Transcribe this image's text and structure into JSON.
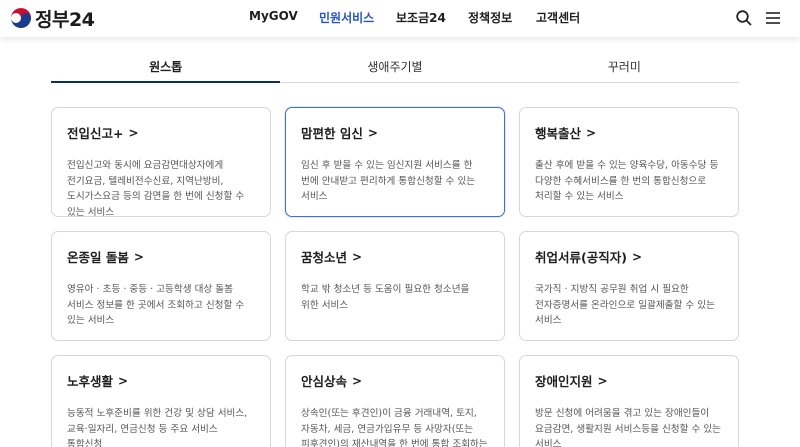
{
  "header": {
    "logo_text": "정부24",
    "nav": [
      {
        "label": "MyGOV",
        "active": false
      },
      {
        "label": "민원서비스",
        "active": true
      },
      {
        "label": "보조금24",
        "active": false
      },
      {
        "label": "정책정보",
        "active": false
      },
      {
        "label": "고객센터",
        "active": false
      }
    ],
    "icons": [
      "search-icon",
      "menu-icon"
    ]
  },
  "tabs": [
    {
      "label": "원스톱",
      "active": true
    },
    {
      "label": "생애주기별",
      "active": false
    },
    {
      "label": "꾸러미",
      "active": false
    }
  ],
  "cards": [
    {
      "title": "전입신고+",
      "desc": "전입신고와 동시에 요금감면대상자에게 전기요금, 텔레비전수신료, 지역난방비, 도시가스요금 등의 감면을 한 번에 신청할 수 있는 서비스",
      "highlight": false
    },
    {
      "title": "맘편한 임신",
      "desc": "임신 후 받을 수 있는 임신지원 서비스를 한 번에 안내받고 편리하게 통합신청할 수 있는 서비스",
      "highlight": true
    },
    {
      "title": "행복출산",
      "desc": "출산 후에 받을 수 있는 양육수당, 아동수당 등 다양한 수혜서비스를 한 번의 통합신청으로 처리할 수 있는 서비스",
      "highlight": false
    },
    {
      "title": "온종일 돌봄",
      "desc": "영유아 · 초등 · 중등 · 고등학생 대상 돌봄 서비스 정보를 한 곳에서 조회하고 신청할 수 있는 서비스",
      "highlight": false
    },
    {
      "title": "꿈청소년",
      "desc": "학교 밖 청소년 등 도움이 필요한 청소년을 위한 서비스",
      "highlight": false
    },
    {
      "title": "취업서류(공직자)",
      "desc": "국가직 · 지방직 공무원 취업 시 필요한 전자증명서를 온라인으로 일괄제출할 수 있는 서비스",
      "highlight": false
    },
    {
      "title": "노후생활",
      "desc": "능동적 노후준비를 위한 건강 및 상담 서비스, 교육·일자리, 연금신청 등 주요 서비스 통합신청",
      "highlight": false
    },
    {
      "title": "안심상속",
      "desc": "상속인(또는 후견인)이 금융 거래내역, 토지, 자동차, 세금, 연금가입유무 등 사망자(또는 피후견인)의 재산내역을 한 번에 통합 조회하는 서비스",
      "highlight": false
    },
    {
      "title": "장애인지원",
      "desc": "방문 신청에 어려움을 겪고 있는 장애인들이 요금감면, 생활지원 서비스등을 신청할 수 있는 서비스",
      "highlight": false
    }
  ],
  "colors": {
    "accent_blue": "#2654c9",
    "tab_underline": "#0b2f6b",
    "card_highlight_border": "#3f6fd8"
  }
}
